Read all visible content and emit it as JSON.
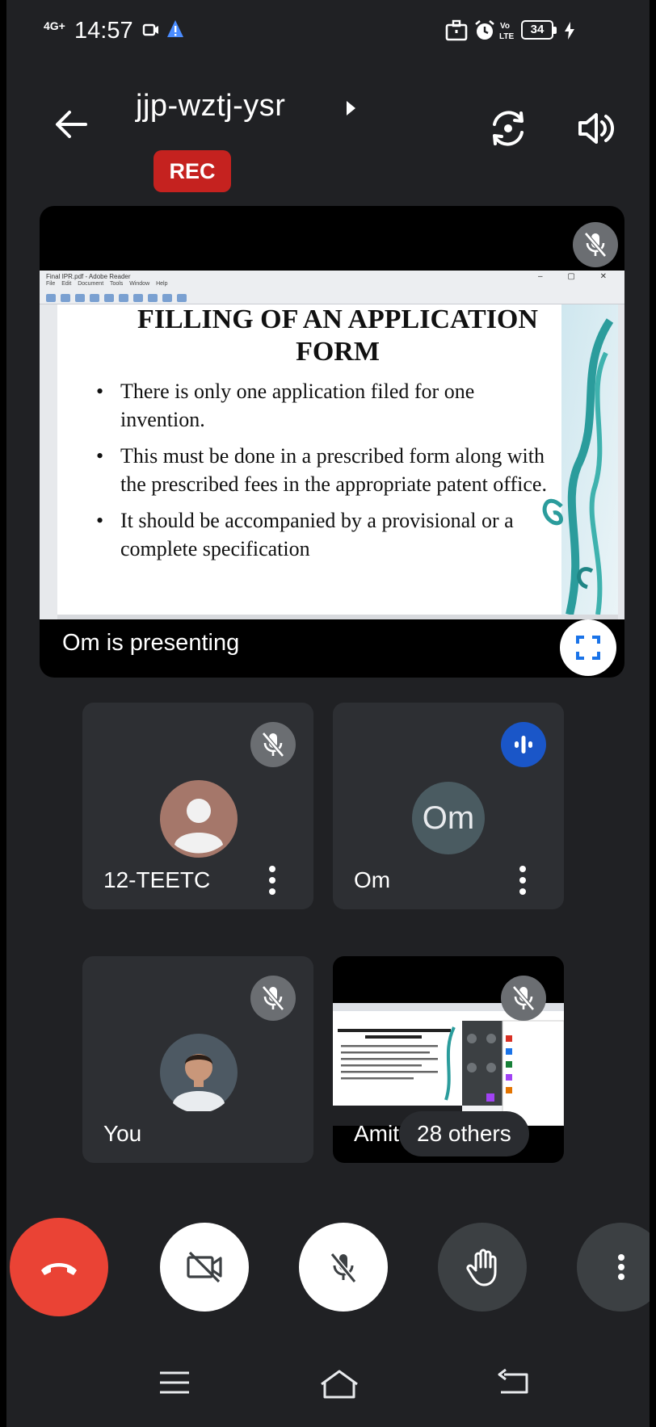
{
  "status_bar": {
    "network": "4G+",
    "time": "14:57",
    "battery": "34"
  },
  "header": {
    "meeting_code": "jjp-wztj-ysr",
    "recording_badge": "REC"
  },
  "presentation": {
    "presenter_caption": "Om is presenting",
    "pdf_window": {
      "title": "Final IPR.pdf - Adobe Reader",
      "menu": "File Edit Document Tools Window Help"
    },
    "slide": {
      "title_line1": "FILLING OF AN APPLICATION",
      "title_line2": "FORM",
      "bullets": [
        "There is only one application filed for one invention.",
        "This must be done in a prescribed form along with the prescribed fees in the appropriate patent office.",
        "It should be accompanied by a provisional or a complete specification"
      ]
    }
  },
  "participants": [
    {
      "name": "12-TEETC",
      "muted": true,
      "avatar": "generic-person"
    },
    {
      "name": "Om",
      "avatar_initials": "Om",
      "speaking": true
    },
    {
      "name": "You",
      "muted": true,
      "avatar": "photo"
    },
    {
      "name": "Amit",
      "muted": true,
      "others_label": "28 others"
    }
  ],
  "controls": [
    {
      "name": "end-call",
      "icon": "hangup-icon",
      "color": "#ea4335"
    },
    {
      "name": "camera",
      "icon": "camera-off-icon"
    },
    {
      "name": "microphone",
      "icon": "mic-off-icon"
    },
    {
      "name": "raise-hand",
      "icon": "hand-icon"
    },
    {
      "name": "more",
      "icon": "more-vertical-icon"
    }
  ],
  "colors": {
    "background": "#202124",
    "tile": "#2d2f33",
    "rec": "#c5221f",
    "speaking": "#1a56c8",
    "hangup": "#ea4335"
  }
}
